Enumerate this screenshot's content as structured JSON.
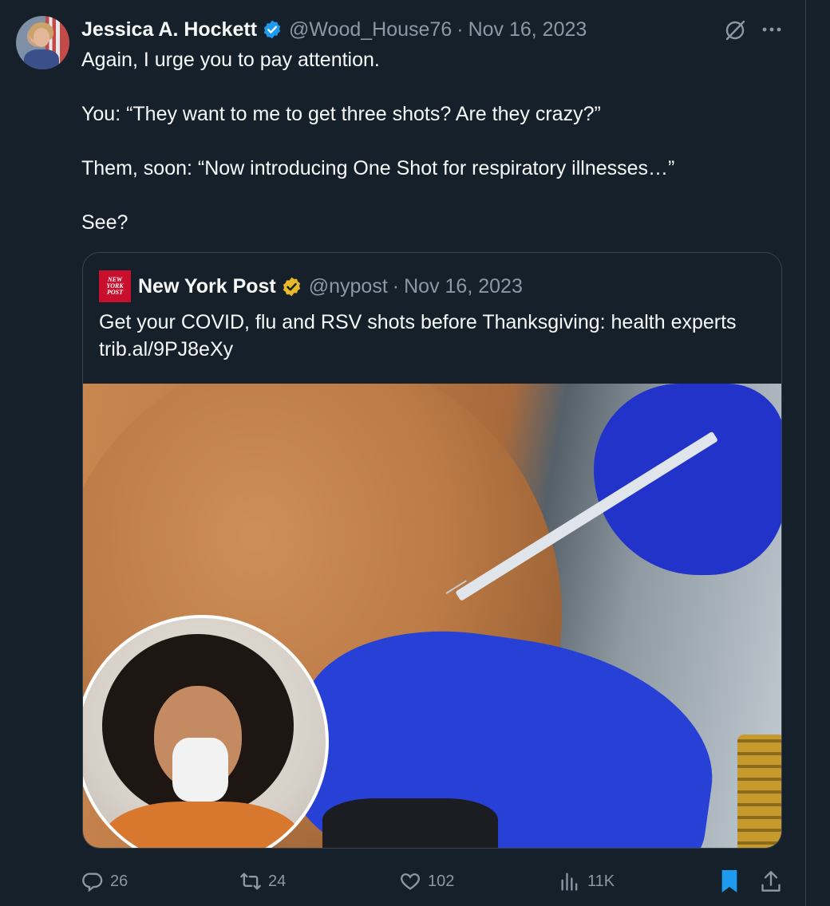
{
  "tweet": {
    "author_name": "Jessica A. Hockett",
    "handle": "@Wood_House76",
    "separator": "·",
    "date": "Nov 16, 2023",
    "paragraphs": [
      "Again, I urge you to pay attention.",
      "You: “They want to me to get three shots? Are they crazy?”",
      "Them, soon: “Now introducing One Shot for respiratory illnesses…”",
      "See?"
    ]
  },
  "quote": {
    "logo_lines": [
      "NEW",
      "YORK",
      "POST"
    ],
    "author_name": "New York Post",
    "handle": "@nypost",
    "separator": "·",
    "date": "Nov 16, 2023",
    "text_line1": "Get your COVID, flu and RSV shots before Thanksgiving: health experts",
    "text_line2": "trib.al/9PJ8eXy"
  },
  "actions": {
    "replies": "26",
    "reposts": "24",
    "likes": "102",
    "views": "11K"
  },
  "colors": {
    "background": "#15202b",
    "verified_blue": "#1d9bf0",
    "verified_gold": "#e8b829",
    "muted": "#8b98a5",
    "nyp_red": "#c8102e"
  },
  "icons": [
    "grok-icon",
    "more-icon",
    "reply-icon",
    "repost-icon",
    "like-icon",
    "views-icon",
    "bookmark-icon",
    "share-icon"
  ]
}
